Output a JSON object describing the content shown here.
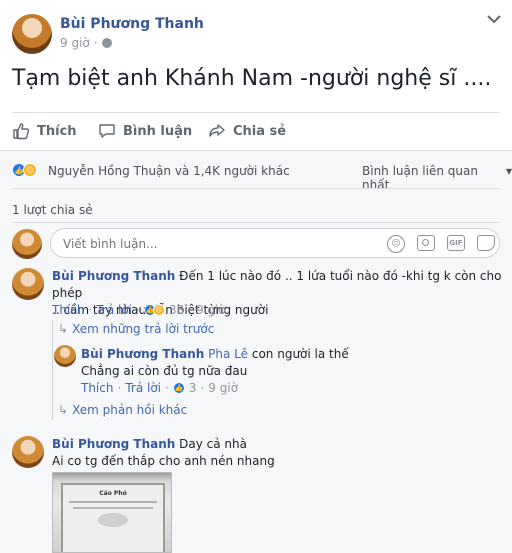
{
  "post": {
    "author": "Bùi Phương Thanh",
    "time": "9 giờ",
    "sep": "·",
    "text": "Tạm biệt anh Khánh Nam -người nghệ sĩ ....",
    "more": "⌄"
  },
  "actions": {
    "like": "Thích",
    "comment": "Bình luận",
    "share": "Chia sẻ"
  },
  "reactions": {
    "summary": "Nguyễn Hồng Thuận và 1,4K người khác",
    "sort": "Bình luận liên quan nhất",
    "sort_arrow": "▾",
    "share_count": "1 lượt chia sẻ"
  },
  "composer": {
    "placeholder": "Viết bình luận..."
  },
  "comments": [
    {
      "author": "Bùi Phương Thanh",
      "text_line1": "Đến 1 lúc nào đó .. 1 lứa tuổi nào đó -khi tg k còn cho phép",
      "text_line2": ".. cầm tay nhau tiễn biệt từng người",
      "like": "Thích",
      "reply": "Trả lời",
      "dot": "·",
      "count": "38",
      "time": "9 giờ",
      "view_prev": "Xem những trả lời trước",
      "replies": [
        {
          "author": "Bùi Phương Thanh",
          "tag": "Pha Lê",
          "text_line1": "con người la thế",
          "text_line2": "Chẳng ai còn đủ tg nữa đau",
          "like": "Thích",
          "reply": "Trả lời",
          "dot": "·",
          "count": "3",
          "time": "9 giờ"
        }
      ],
      "view_more": "Xem phản hồi khác"
    },
    {
      "author": "Bùi Phương Thanh",
      "text_line1": "Day cả nhà",
      "text_line2": "Ai co tg đến thắp cho anh nén nhang",
      "image_caption": "Cáo Phó"
    }
  ],
  "colors": {
    "brand_blue": "#4267b2",
    "name_blue": "#365899",
    "muted": "#90949c",
    "like_blue": "#1877f2",
    "sad_yellow": "#f7b125"
  }
}
